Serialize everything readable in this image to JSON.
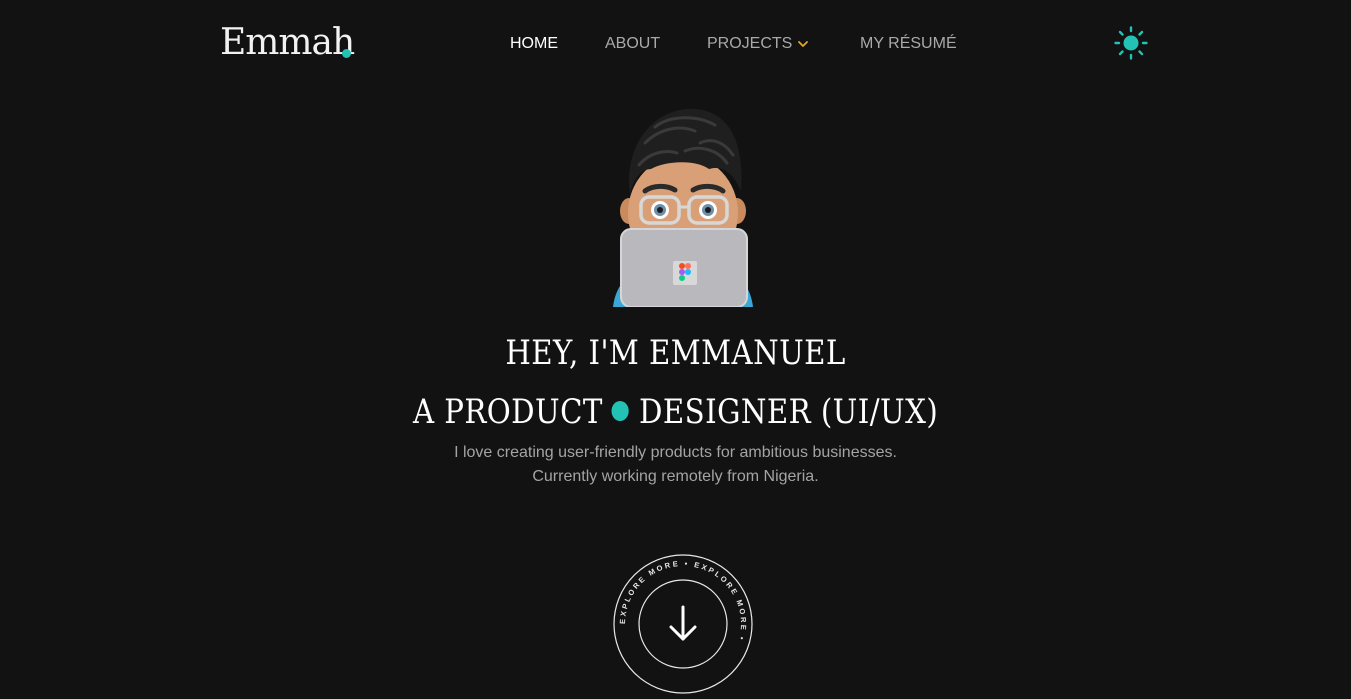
{
  "brand": {
    "logo_text": "Emmah",
    "accent_color": "#22c3b5"
  },
  "nav": {
    "items": [
      {
        "label": "HOME",
        "active": true
      },
      {
        "label": "ABOUT",
        "active": false
      },
      {
        "label": "PROJECTS",
        "active": false,
        "has_dropdown": true
      },
      {
        "label": "MY RÉSUMÉ",
        "active": false
      }
    ],
    "theme_icon": "sun-icon"
  },
  "hero": {
    "line1": "HEY, I'M EMMANUEL",
    "line2_part1": "A PRODUCT",
    "line2_part2": "DESIGNER (UI/UX)",
    "subtitle_1": "I love creating user-friendly products for ambitious businesses.",
    "subtitle_2": "Currently working remotely from Nigeria."
  },
  "explore": {
    "ring_text": "EXPLORE MORE • EXPLORE MORE •",
    "icon": "arrow-down-icon"
  }
}
